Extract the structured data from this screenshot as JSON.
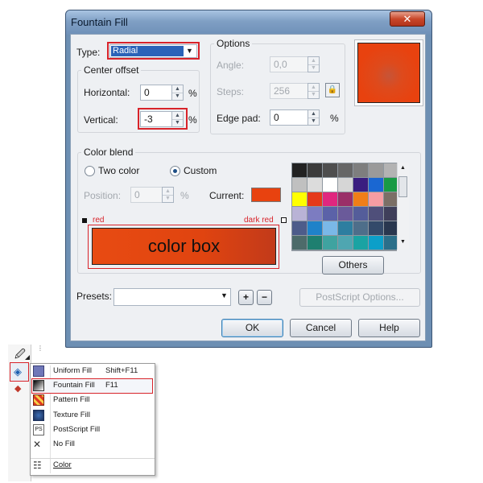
{
  "window": {
    "title": "Fountain Fill",
    "close_glyph": "✕"
  },
  "type_row": {
    "label": "Type:",
    "value": "Radial"
  },
  "center_offset": {
    "title": "Center offset",
    "horizontal_label": "Horizontal:",
    "horizontal_value": "0",
    "horizontal_unit": "%",
    "vertical_label": "Vertical:",
    "vertical_value": "-3",
    "vertical_unit": "%"
  },
  "options": {
    "title": "Options",
    "angle_label": "Angle:",
    "angle_value": "0,0",
    "steps_label": "Steps:",
    "steps_value": "256",
    "edge_pad_label": "Edge pad:",
    "edge_pad_value": "0",
    "edge_pad_unit": "%"
  },
  "color_blend": {
    "title": "Color blend",
    "two_color_label": "Two color",
    "custom_label": "Custom",
    "selected_mode": "Custom",
    "position_label": "Position:",
    "position_value": "0",
    "position_unit": "%",
    "current_label": "Current:",
    "current_color": "#e8420f",
    "start_label": "red",
    "end_label": "dark red",
    "color_box_text": "color box",
    "others_button": "Others"
  },
  "palette_colors": [
    "#222222",
    "#3b3b3b",
    "#4e4e4e",
    "#666666",
    "#7e7e7e",
    "#9a9a9a",
    "#b3b3b3",
    "#c0c0c0",
    "#dcdcdc",
    "#ffffff",
    "#d6d6d6",
    "#3a1d7f",
    "#1a67d2",
    "#199a45",
    "#ffff00",
    "#e5391a",
    "#e0277f",
    "#9a2f68",
    "#f07e18",
    "#f59da3",
    "#7b6f66",
    "#b9b3d6",
    "#7c7cc1",
    "#5b62a8",
    "#6a5a9a",
    "#545d9a",
    "#4f4f7a",
    "#3f3f5a",
    "#4d5c8a",
    "#1f82c9",
    "#7ab8e8",
    "#2d7ea0",
    "#4e6e8a",
    "#334a6a",
    "#29374f",
    "#4d6b6a",
    "#1e7f70",
    "#3fa3a0",
    "#4fa6b1",
    "#1aa3a3",
    "#0c9fc9",
    "#2b6f8a"
  ],
  "presets": {
    "label": "Presets:",
    "value": "",
    "add_glyph": "+",
    "remove_glyph": "−"
  },
  "postscript_button": "PostScript Options...",
  "buttons": {
    "ok": "OK",
    "cancel": "Cancel",
    "help": "Help"
  },
  "preview_color": "#e8420f",
  "flyout": {
    "items": [
      {
        "label": "Uniform Fill",
        "shortcut": "Shift+F11",
        "icon": "uniform-fill-icon"
      },
      {
        "label": "Fountain Fill",
        "shortcut": "F11",
        "icon": "fountain-fill-icon"
      },
      {
        "label": "Pattern Fill",
        "shortcut": "",
        "icon": "pattern-fill-icon"
      },
      {
        "label": "Texture Fill",
        "shortcut": "",
        "icon": "texture-fill-icon"
      },
      {
        "label": "PostScript Fill",
        "shortcut": "",
        "icon": "postscript-fill-icon"
      },
      {
        "label": "No Fill",
        "shortcut": "",
        "icon": "no-fill-icon"
      },
      {
        "label": "Color",
        "shortcut": "",
        "icon": "color-docker-icon"
      }
    ],
    "highlighted": "Fountain Fill"
  }
}
